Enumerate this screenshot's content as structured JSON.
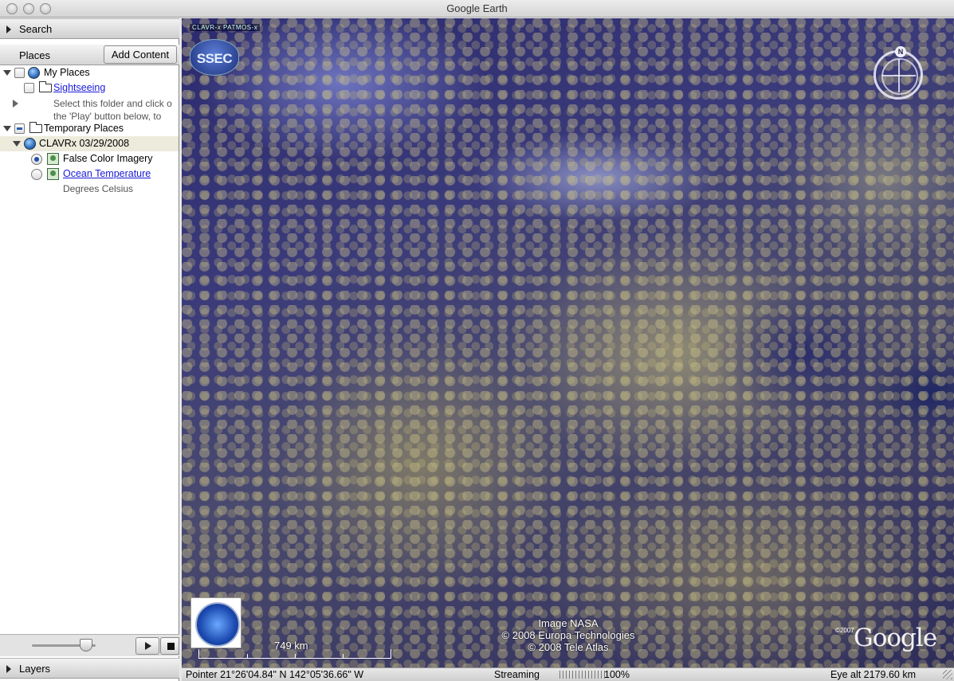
{
  "window": {
    "title": "Google Earth"
  },
  "sidebar": {
    "search_label": "Search",
    "places_label": "Places",
    "add_content_label": "Add Content",
    "layers_label": "Layers",
    "tree": {
      "my_places": "My Places",
      "sightseeing": "Sightseeing",
      "sightseeing_desc_line1": "Select this folder and click o",
      "sightseeing_desc_line2": "the 'Play' button below, to",
      "temporary_places": "Temporary Places",
      "clavrx": "CLAVRx 03/29/2008",
      "false_color": "False Color Imagery",
      "ocean_temp": "Ocean Temperature",
      "ocean_temp_desc": "Degrees Celsius"
    },
    "tour_slider_level": 0.85
  },
  "map": {
    "top_label": "CLAVR-x  PATMOS-x",
    "ssec_logo_text": "SSEC",
    "compass_n": "N",
    "scale_label": "749 km",
    "attribution": [
      "Image NASA",
      "© 2008 Europa Technologies",
      "© 2008 Tele Atlas"
    ],
    "google_year": "©2007",
    "google_logo": "Google"
  },
  "status": {
    "pointer": "Pointer  21°26'04.84\" N  142°05'36.66\" W",
    "streaming_label": "Streaming",
    "streaming_pct": "100%",
    "eye_alt": "Eye alt  2179.60 km"
  }
}
